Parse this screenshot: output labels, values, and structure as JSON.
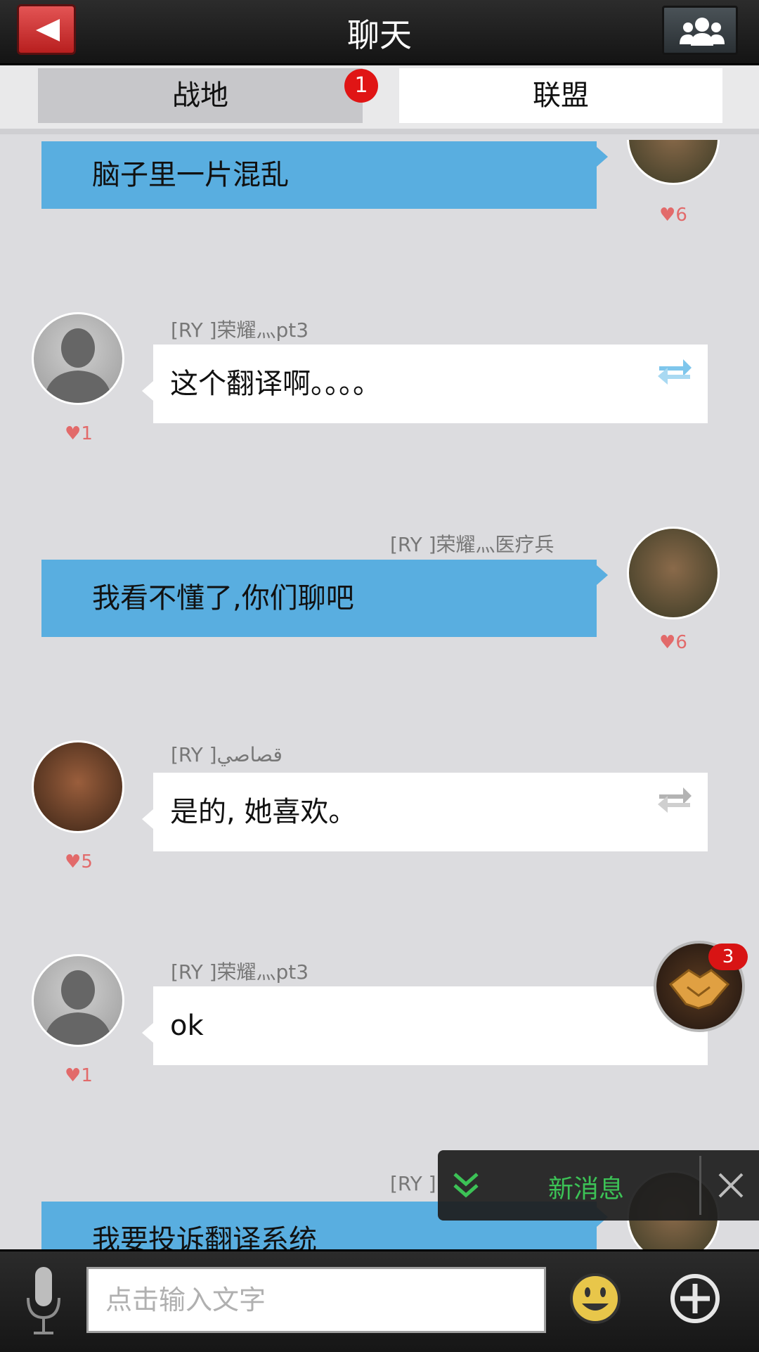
{
  "header": {
    "title": "聊天"
  },
  "tabs": [
    {
      "label": "战地",
      "badge": "1"
    },
    {
      "label": "联盟"
    }
  ],
  "messages": [
    {
      "side": "right",
      "text": "脑子里一片混乱",
      "likes": "6"
    },
    {
      "side": "left",
      "sender": "[RY ]荣耀灬pt3",
      "text": "这个翻译啊。。。。",
      "likes": "1"
    },
    {
      "side": "right",
      "sender": "[RY ]荣耀灬医疗兵",
      "text": "我看不懂了,你们聊吧",
      "likes": "6"
    },
    {
      "side": "left",
      "sender": "[RY ]قصاصي",
      "text": "是的, 她喜欢。",
      "likes": "5"
    },
    {
      "side": "left",
      "sender": "[RY ]荣耀灬pt3",
      "text": "ok",
      "likes": "1"
    },
    {
      "side": "right",
      "sender": "[RY ]",
      "text": "我要投诉翻译系统"
    }
  ],
  "alliance_fab": {
    "badge": "3"
  },
  "new_message": {
    "label": "新消息"
  },
  "input": {
    "placeholder": "点击输入文字"
  },
  "colors": {
    "bubble_self": "#59aee0",
    "new_message_text": "#3cc256",
    "badge": "#e01515",
    "likes": "#e26a6a"
  }
}
